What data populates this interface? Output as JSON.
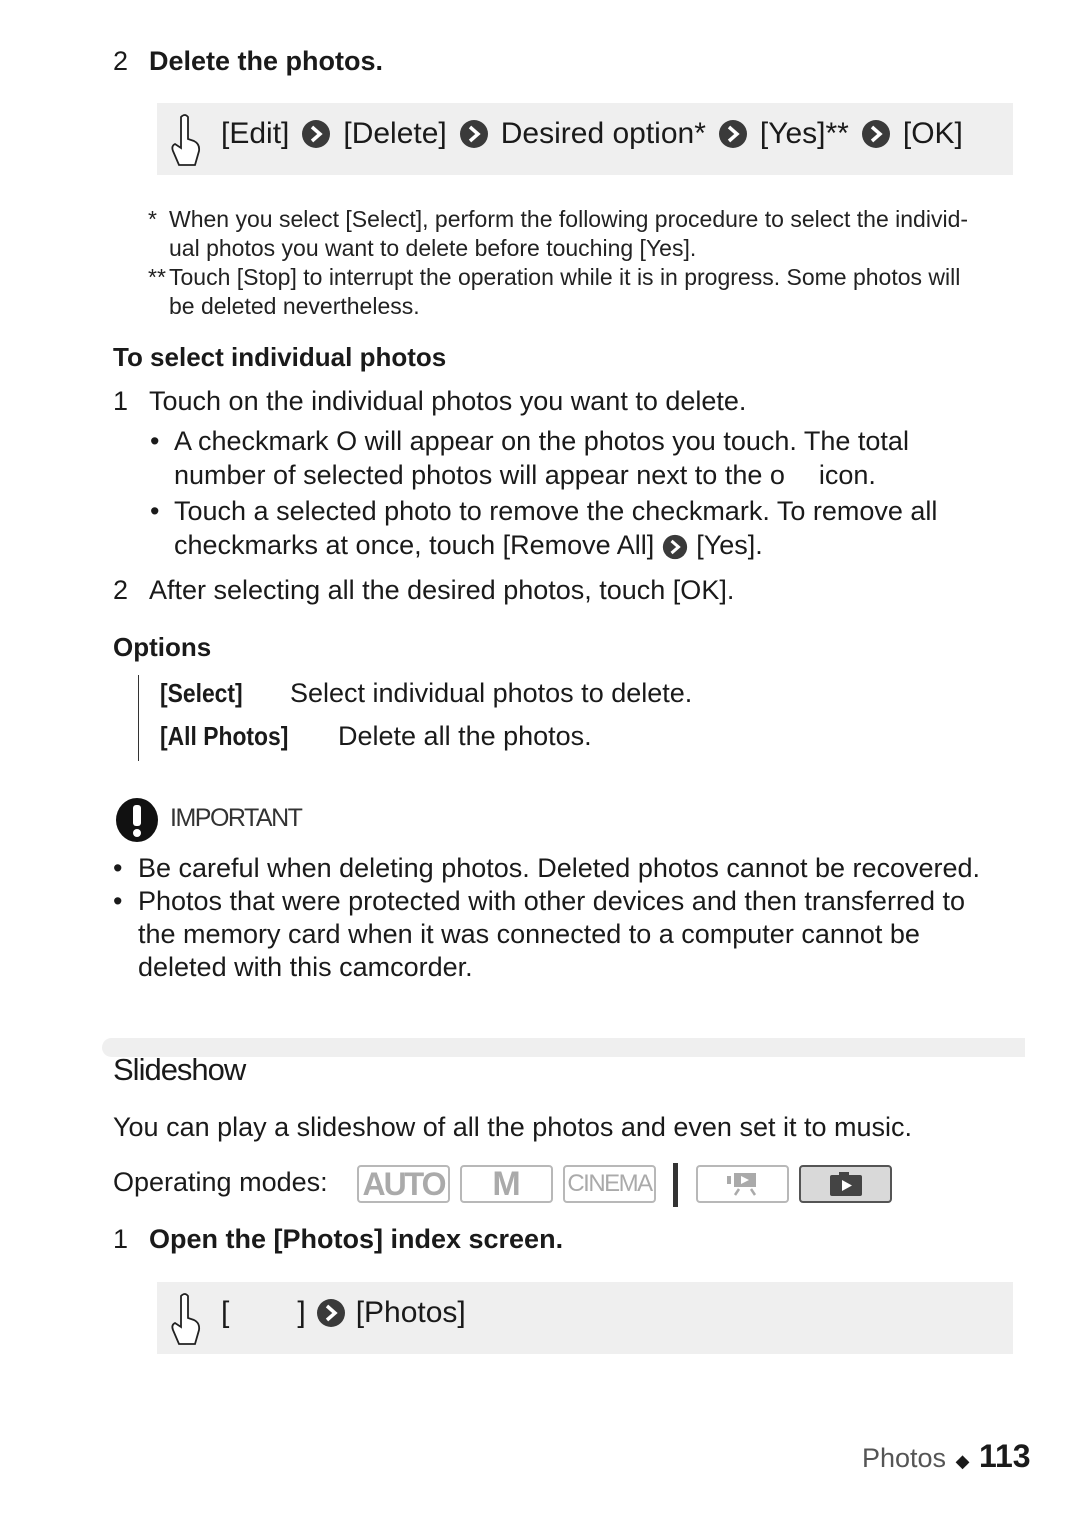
{
  "step_delete": {
    "number": "2",
    "title": "Delete the photos."
  },
  "procedure_delete": {
    "icon": "touch-hand-icon",
    "items": [
      "[Edit]",
      "[Delete]",
      "Desired option*",
      "[Yes]**",
      "[OK]"
    ],
    "separator_icon": "chevron-right-circle-icon"
  },
  "footnotes": [
    {
      "mark": "*",
      "text_line1": "When you select [Select], perform the following procedure to select the individ-",
      "text_line2": "ual photos you want to delete before touching [Yes]."
    },
    {
      "mark": "**",
      "text_line1": "Touch [Stop] to interrupt the operation while it is in progress. Some photos will",
      "text_line2": "be deleted nevertheless."
    }
  ],
  "select_individual": {
    "heading": "To select individual photos",
    "step1": {
      "number": "1",
      "text": "Touch on the individual photos you want to delete."
    },
    "bullets": [
      {
        "line1_a": "A checkmark ",
        "checkmark_glyph": "O",
        "line1_b": " will appear on the photos you touch. The total",
        "line2_a": "number of selected photos will appear next to the ",
        "icon_glyph": "o",
        "line2_b": "icon."
      },
      {
        "line1": "Touch a selected photo to remove the checkmark. To remove all",
        "line2_a": "checkmarks at once, touch [Remove All]",
        "line2_b": "[Yes]."
      }
    ],
    "step2": {
      "number": "2",
      "text": "After selecting all the desired photos, touch [OK]."
    }
  },
  "options": {
    "heading": "Options",
    "items": [
      {
        "label": "[Select]",
        "description": "Select individual photos to delete."
      },
      {
        "label": "[All Photos]",
        "description": "Delete all the photos."
      }
    ]
  },
  "important": {
    "icon": "exclamation-icon",
    "label": "IMPORTANT",
    "bullets": [
      {
        "lines": [
          "Be careful when deleting photos. Deleted photos cannot be recovered."
        ]
      },
      {
        "lines": [
          "Photos that were protected with other devices and then transferred to",
          "the memory card when it was connected to a computer cannot be",
          "deleted with this camcorder."
        ]
      }
    ]
  },
  "slideshow": {
    "heading": "Slideshow",
    "intro": "You can play a slideshow of all the photos and even set it to music.",
    "operating_modes_label": "Operating modes:",
    "modes": [
      {
        "label": "AUTO",
        "active": false
      },
      {
        "label": "M",
        "active": false
      },
      {
        "label": "CINEMA",
        "active": false
      },
      {
        "icon": "movie-playback-icon",
        "active": false
      },
      {
        "icon": "photo-playback-icon",
        "active": true
      }
    ],
    "step1": {
      "number": "1",
      "text": "Open the [Photos] index screen."
    },
    "procedure": {
      "icon": "touch-hand-icon",
      "bracket_open": "[",
      "bracket_close": "]",
      "item": "[Photos]"
    }
  },
  "footer": {
    "section": "Photos",
    "separator": "◆",
    "page_number": "113"
  }
}
